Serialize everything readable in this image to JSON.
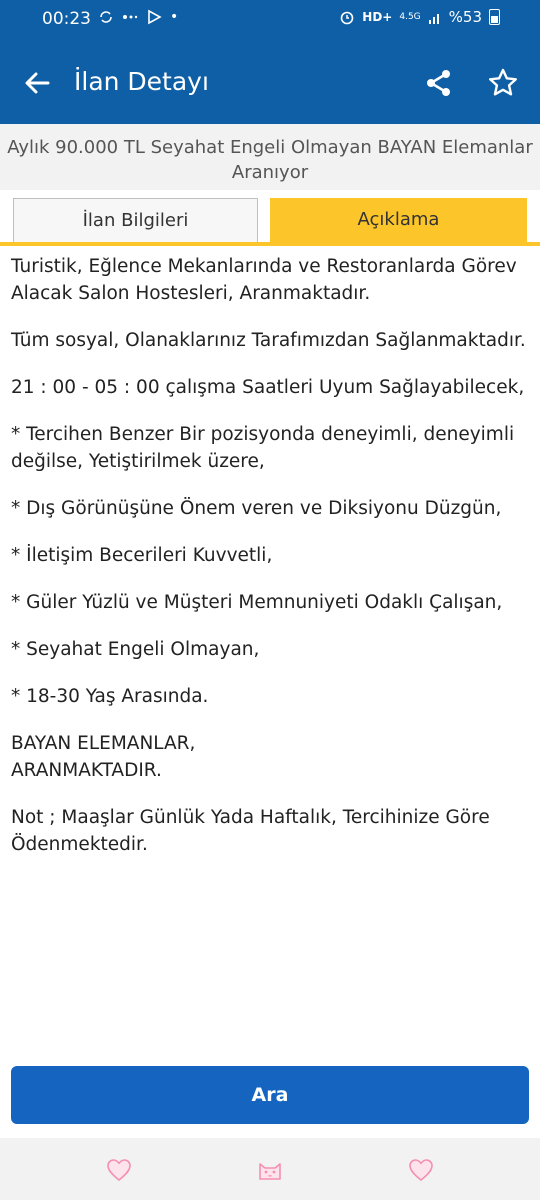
{
  "status_bar": {
    "time": "00:23",
    "battery": "%53",
    "network": "4.5G"
  },
  "app_bar": {
    "title": "İlan Detayı",
    "back_icon": "arrow-left-icon",
    "share_icon": "share-icon",
    "favorite_icon": "star-outline-icon"
  },
  "ad": {
    "title": "Aylık 90.000 TL Seyahat Engeli Olmayan BAYAN Elemanlar Aranıyor"
  },
  "tabs": [
    {
      "label": "İlan Bilgileri",
      "active": false
    },
    {
      "label": "Açıklama",
      "active": true
    }
  ],
  "description": [
    "Turistik, Eğlence Mekanlarında ve Restoranlarda Görev Alacak Salon Hostesleri, Aranmaktadır.",
    "Tüm sosyal, Olanaklarınız Tarafımızdan Sağlanmaktadır.",
    "21 : 00 - 05 : 00 çalışma Saatleri Uyum Sağlayabilecek,",
    "* Tercihen Benzer Bir pozisyonda deneyimli, deneyimli değilse, Yetiştirilmek üzere,",
    "* Dış Görünüşüne Önem veren ve Diksiyonu Düzgün,",
    "* İletişim Becerileri Kuvvetli,",
    "* Güler Yüzlü ve Müşteri Memnuniyeti Odaklı Çalışan,",
    "* Seyahat Engeli Olmayan,",
    "* 18-30 Yaş Arasında.",
    "BAYAN ELEMANLAR,\nARANMAKTADIR.",
    "Not ; Maaşlar Günlük Yada Haftalık, Tercihinize Göre Ödenmektedir."
  ],
  "actions": {
    "search_label": "Ara"
  },
  "colors": {
    "primary": "#0e5fa6",
    "accent": "#fcc62a",
    "button": "#1565c0",
    "nav_icon": "#f48fb1"
  },
  "nav_bar": {
    "icons": [
      "heart-icon",
      "cat-face-icon",
      "heart-icon"
    ]
  }
}
